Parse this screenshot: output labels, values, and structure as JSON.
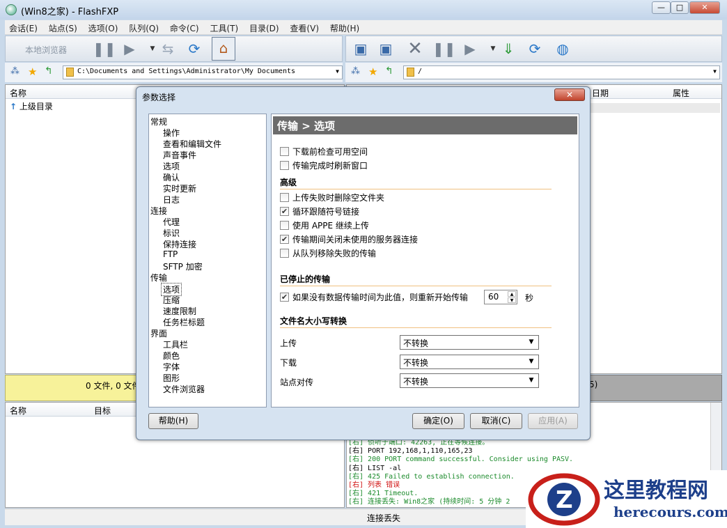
{
  "window": {
    "title": "(Win8之家) - FlashFXP",
    "min": "—",
    "max": "□",
    "close": "✕"
  },
  "menu": [
    "会话(E)",
    "站点(S)",
    "选项(O)",
    "队列(Q)",
    "命令(C)",
    "工具(T)",
    "目录(D)",
    "查看(V)",
    "帮助(H)"
  ],
  "left": {
    "toolbar_label": "本地浏览器",
    "path": "C:\\Documents and Settings\\Administrator\\My Documents",
    "col_name": "名称",
    "parent_dir": "上级目录",
    "status": "0 文件, 0 文件"
  },
  "right": {
    "path": "/",
    "col_date": "日期",
    "col_attr": "属性",
    "status_tail": "5)"
  },
  "queue": {
    "col_name": "名称",
    "col_target": "目标"
  },
  "log": [
    {
      "text": "[右] 侦听于端口: 42263, 正在等候连接。",
      "color": "#1a8a2a"
    },
    {
      "text": "[右] PORT 192,168,1,110,165,23",
      "color": "#000"
    },
    {
      "text": "[右] 200 PORT command successful. Consider using PASV.",
      "color": "#1a8a2a"
    },
    {
      "text": "[右] LIST -al",
      "color": "#000"
    },
    {
      "text": "[右] 425 Failed to establish connection.",
      "color": "#1a8a2a"
    },
    {
      "text": "[右] 列表 错误",
      "color": "#d01010"
    },
    {
      "text": "[右] 421 Timeout.",
      "color": "#1a8a2a"
    },
    {
      "text": "[右] 连接丢失: Win8之家 (持续时间: 5 分钟 2",
      "color": "#1a8a2a"
    }
  ],
  "bottom_status": "连接丢失",
  "dialog": {
    "title": "参数选择",
    "close": "✕",
    "tree": [
      {
        "label": "常规",
        "level": 0
      },
      {
        "label": "操作",
        "level": 1
      },
      {
        "label": "查看和编辑文件",
        "level": 1
      },
      {
        "label": "声音事件",
        "level": 1
      },
      {
        "label": "选项",
        "level": 1
      },
      {
        "label": "确认",
        "level": 1
      },
      {
        "label": "实时更新",
        "level": 1
      },
      {
        "label": "日志",
        "level": 1
      },
      {
        "label": "连接",
        "level": 0
      },
      {
        "label": "代理",
        "level": 1
      },
      {
        "label": "标识",
        "level": 1
      },
      {
        "label": "保持连接",
        "level": 1
      },
      {
        "label": "FTP",
        "level": 1
      },
      {
        "label": "SFTP 加密",
        "level": 1
      },
      {
        "label": "传输",
        "level": 0
      },
      {
        "label": "选项",
        "level": 1,
        "selected": true
      },
      {
        "label": "压缩",
        "level": 1
      },
      {
        "label": "速度限制",
        "level": 1
      },
      {
        "label": "任务栏标题",
        "level": 1
      },
      {
        "label": "界面",
        "level": 0
      },
      {
        "label": "工具栏",
        "level": 1
      },
      {
        "label": "颜色",
        "level": 1
      },
      {
        "label": "字体",
        "level": 1
      },
      {
        "label": "图形",
        "level": 1
      },
      {
        "label": "文件浏览器",
        "level": 1
      }
    ],
    "panel_title": "传输 > 选项",
    "opts_top": [
      {
        "label": "下载前检查可用空间",
        "checked": false
      },
      {
        "label": "传输完成时刷新窗口",
        "checked": false
      }
    ],
    "sect_adv": "高级",
    "opts_adv": [
      {
        "label": "上传失败时删除空文件夹",
        "checked": false
      },
      {
        "label": "循环跟随符号链接",
        "checked": true
      },
      {
        "label": "使用 APPE 继续上传",
        "checked": false
      },
      {
        "label": "传输期间关闭未使用的服务器连接",
        "checked": true
      },
      {
        "label": "从队列移除失败的传输",
        "checked": false
      }
    ],
    "sect_stopped": "已停止的传输",
    "stalled_label": "如果没有数据传输时间为此值，则重新开始传输",
    "stalled_checked": true,
    "stalled_value": "60",
    "stalled_unit": "秒",
    "sect_case": "文件名大小写转换",
    "case_rows": [
      {
        "label": "上传",
        "value": "不转换"
      },
      {
        "label": "下载",
        "value": "不转换"
      },
      {
        "label": "站点对传",
        "value": "不转换"
      }
    ],
    "btn_help": "帮助(H)",
    "btn_ok": "确定(O)",
    "btn_cancel": "取消(C)",
    "btn_apply": "应用(A)"
  },
  "watermark": {
    "cn": "这里教程网",
    "en": "herecours.com"
  }
}
